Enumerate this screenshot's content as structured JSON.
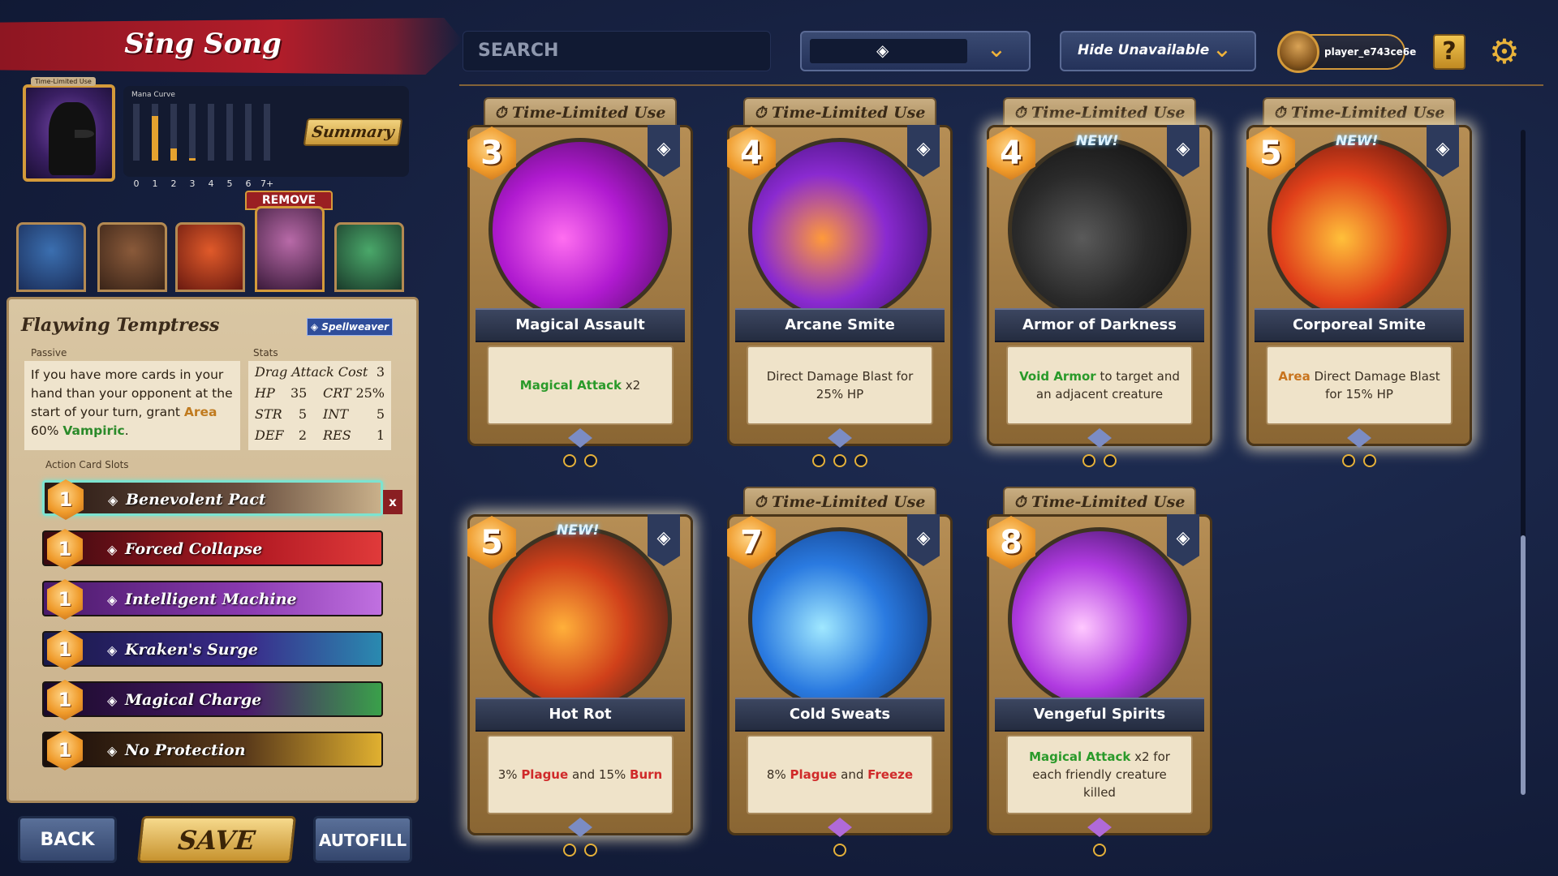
{
  "deck": {
    "title": "Sing Song",
    "hero_tag": "Time-Limited Use",
    "mana_curve_label": "Mana Curve",
    "mana_curve": [
      {
        "tick": "0",
        "fill": 0.0
      },
      {
        "tick": "1",
        "fill": 0.78
      },
      {
        "tick": "2",
        "fill": 0.22
      },
      {
        "tick": "3",
        "fill": 0.05
      },
      {
        "tick": "4",
        "fill": 0.0
      },
      {
        "tick": "5",
        "fill": 0.0
      },
      {
        "tick": "6",
        "fill": 0.0
      },
      {
        "tick": "7+",
        "fill": 0.0
      }
    ],
    "summary_label": "Summary",
    "remove_label": "REMOVE",
    "party": [
      {
        "name": "dragon-portrait",
        "colors": [
          "#3b6fb0",
          "#1b2e5a"
        ]
      },
      {
        "name": "boar-warrior-portrait",
        "colors": [
          "#8a5a3a",
          "#3a2418"
        ]
      },
      {
        "name": "phoenix-portrait",
        "colors": [
          "#e05a2a",
          "#6a1a10"
        ]
      },
      {
        "name": "temptress-portrait",
        "colors": [
          "#b86aa8",
          "#3a1a3a"
        ]
      },
      {
        "name": "lizard-shaman-portrait",
        "colors": [
          "#4aa86a",
          "#1a3a2a"
        ]
      }
    ]
  },
  "hero": {
    "name": "Flaywing Temptress",
    "class": "Spellweaver",
    "passive_label": "Passive",
    "passive_pre": "If you have more cards in your hand than your opponent at the start of your turn, grant ",
    "passive_area": "Area",
    "passive_mid": " 60% ",
    "passive_vamp": "Vampiric",
    "passive_end": ".",
    "stats_label": "Stats",
    "drag_label": "Drag Attack Cost",
    "drag_value": "3",
    "stats": {
      "hp_label": "HP",
      "hp": "35",
      "crt_label": "CRT",
      "crt": "25%",
      "str_label": "STR",
      "str": "5",
      "int_label": "INT",
      "int": "5",
      "def_label": "DEF",
      "def": "2",
      "res_label": "RES",
      "res": "1"
    },
    "slots_label": "Action Card Slots",
    "slots": [
      {
        "cost": "1",
        "name": "Benevolent Pact",
        "colors": [
          "#2a1a14",
          "#6a5040",
          "#c9b08a"
        ]
      },
      {
        "cost": "1",
        "name": "Forced Collapse",
        "colors": [
          "#3a0a10",
          "#b01822",
          "#e03a3a"
        ]
      },
      {
        "cost": "1",
        "name": "Intelligent Machine",
        "colors": [
          "#4a1a6a",
          "#8a3ab0",
          "#c070e0"
        ]
      },
      {
        "cost": "1",
        "name": "Kraken's Surge",
        "colors": [
          "#1a1a4a",
          "#3a2a8a",
          "#2a8ab0"
        ]
      },
      {
        "cost": "1",
        "name": "Magical Charge",
        "colors": [
          "#1a0a2a",
          "#4a1a6a",
          "#3aa04a"
        ]
      },
      {
        "cost": "1",
        "name": "No Protection",
        "colors": [
          "#1a0e0a",
          "#5a3a1a",
          "#e0b030"
        ]
      }
    ],
    "remove_slot_label": "x"
  },
  "controls": {
    "back": "BACK",
    "save": "SAVE",
    "autofill": "AUTOFILL"
  },
  "topbar": {
    "search_placeholder": "SEARCH",
    "filter_icon": "diamond-icon",
    "hide_label": "Hide Unavailable",
    "player_name": "player_e743ce6e",
    "help": "?",
    "settings": "⚙"
  },
  "cards": [
    {
      "tab": "Time-Limited Use",
      "cost": "3",
      "name": "Magical Assault",
      "new": "",
      "art": [
        "#ff6ef0",
        "#b01ad0",
        "#3a0a4a"
      ],
      "glow": false,
      "gem": "blue",
      "desc": [
        {
          "t": "Magical Attack",
          "c": "green"
        },
        {
          "t": " x2",
          "c": ""
        }
      ],
      "copies": 2
    },
    {
      "tab": "Time-Limited Use",
      "cost": "4",
      "name": "Arcane Smite",
      "new": "",
      "art": [
        "#ff9a3a",
        "#8a2ad0",
        "#2a0a5a"
      ],
      "glow": false,
      "gem": "blue",
      "desc": [
        {
          "t": "Direct Damage Blast for 25% HP",
          "c": ""
        }
      ],
      "copies": 3
    },
    {
      "tab": "Time-Limited Use",
      "cost": "4",
      "name": "Armor of Darkness",
      "new": "NEW!",
      "art": [
        "#5a5a5a",
        "#2a2a2a",
        "#0a0a0a"
      ],
      "glow": true,
      "gem": "blue",
      "desc": [
        {
          "t": "Void Armor",
          "c": "green"
        },
        {
          "t": " to target and an adjacent creature",
          "c": ""
        }
      ],
      "copies": 2
    },
    {
      "tab": "Time-Limited Use",
      "cost": "5",
      "name": "Corporeal Smite",
      "new": "NEW!",
      "art": [
        "#ffc03a",
        "#e0401a",
        "#3a0a0a"
      ],
      "glow": true,
      "gem": "blue",
      "desc": [
        {
          "t": "Area",
          "c": "orange"
        },
        {
          "t": " Direct Damage Blast for 15% HP",
          "c": ""
        }
      ],
      "copies": 2
    },
    {
      "tab": "",
      "cost": "5",
      "name": "Hot Rot",
      "new": "NEW!",
      "art": [
        "#ffb03a",
        "#d0401a",
        "#1a1a1a"
      ],
      "glow": true,
      "gem": "blue",
      "desc": [
        {
          "t": "3% ",
          "c": ""
        },
        {
          "t": "Plague",
          "c": "red"
        },
        {
          "t": " and 15% ",
          "c": ""
        },
        {
          "t": "Burn",
          "c": "red"
        }
      ],
      "copies": 2
    },
    {
      "tab": "Time-Limited Use",
      "cost": "7",
      "name": "Cold Sweats",
      "new": "",
      "art": [
        "#a0e8ff",
        "#2a7ae0",
        "#0a2a6a"
      ],
      "glow": false,
      "gem": "purple",
      "desc": [
        {
          "t": "8% ",
          "c": ""
        },
        {
          "t": "Plague",
          "c": "red"
        },
        {
          "t": " and ",
          "c": ""
        },
        {
          "t": "Freeze",
          "c": "red"
        }
      ],
      "copies": 1
    },
    {
      "tab": "Time-Limited Use",
      "cost": "8",
      "name": "Vengeful Spirits",
      "new": "",
      "art": [
        "#ffc8ff",
        "#b03ae0",
        "#1a0a3a"
      ],
      "glow": false,
      "gem": "purple",
      "desc": [
        {
          "t": "Magical Attack",
          "c": "green"
        },
        {
          "t": " x2 for each friendly creature killed",
          "c": ""
        }
      ],
      "copies": 1
    }
  ]
}
